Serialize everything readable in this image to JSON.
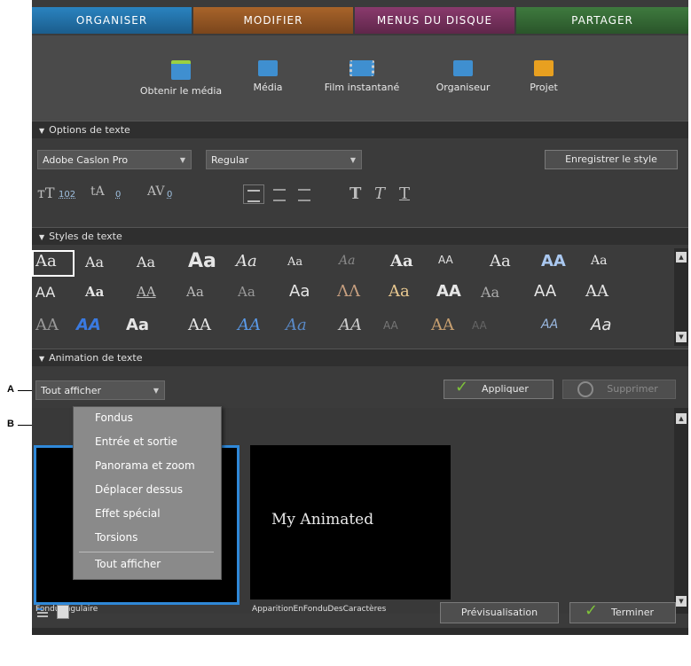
{
  "tabs": [
    "ORGANISER",
    "MODIFIER",
    "MENUS DU DISQUE",
    "PARTAGER"
  ],
  "toolbar": {
    "items": [
      {
        "label": "Obtenir le média",
        "icon": "get-media-icon"
      },
      {
        "label": "Média",
        "icon": "media-icon"
      },
      {
        "label": "Film instantané",
        "icon": "instant-movie-icon"
      },
      {
        "label": "Organiseur",
        "icon": "organizer-icon"
      },
      {
        "label": "Projet",
        "icon": "project-icon"
      }
    ]
  },
  "text_options": {
    "section_title": "Options de texte",
    "font": "Adobe Caslon Pro",
    "style": "Regular",
    "save_style_button": "Enregistrer le style",
    "font_size": "102",
    "leading": "0",
    "tracking": "0"
  },
  "text_styles": {
    "section_title": "Styles de texte"
  },
  "text_animation": {
    "section_title": "Animation de texte",
    "filter_value": "Tout afficher",
    "apply_button": "Appliquer",
    "delete_button": "Supprimer",
    "menu_items": [
      "Fondus",
      "Entrée et sortie",
      "Panorama et zoom",
      "Déplacer dessus",
      "Effet spécial",
      "Torsions",
      "Tout afficher"
    ],
    "thumbnails": [
      {
        "label": "FonduAngulaire",
        "preview": ""
      },
      {
        "label": "ApparitionEnFonduDesCaractères",
        "preview": "My Animated"
      }
    ]
  },
  "footer": {
    "preview_button": "Prévisualisation",
    "done_button": "Terminer"
  },
  "callouts": {
    "a": "A",
    "b": "B"
  },
  "colors": {
    "organiser": "#1b5d8c",
    "modifier": "#7a461c",
    "menus": "#5f264a",
    "partager": "#2a552a",
    "selection": "#2f88d8"
  }
}
